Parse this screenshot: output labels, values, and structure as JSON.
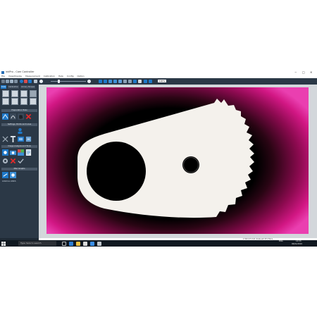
{
  "window": {
    "title": "inkPro - Cam Controller",
    "controls": [
      "−",
      "□",
      "✕"
    ]
  },
  "menu": [
    "File",
    "View/Display",
    "Measurement",
    "Calibration",
    "Help",
    "Config",
    "Option"
  ],
  "toolbar": {
    "zoom_value": "100%",
    "accent": "#1e78c8"
  },
  "left_panel": {
    "tabs": [
      {
        "label": "Data",
        "active": true
      },
      {
        "label": "Calibration",
        "active": false
      },
      {
        "label": "Library Shapes",
        "active": false
      }
    ],
    "sections": {
      "presets": "Preparation Tools",
      "settings": "Settings, Points and Lines",
      "images": "Image Analysis and Tools",
      "misc": "Misc Graphs"
    },
    "misc_label": "LOGICAL LINKS"
  },
  "status_bar": {
    "text": "1.54X 0.5 Unit: Scale set 471 Trans"
  },
  "taskbar": {
    "search_placeholder": "Type here to search",
    "time": "14:33",
    "date": "06/01/2019",
    "language": "ENG"
  },
  "image_colors": {
    "part": "#f4f1ec",
    "hole": "#000000",
    "glow": "#d21784"
  }
}
